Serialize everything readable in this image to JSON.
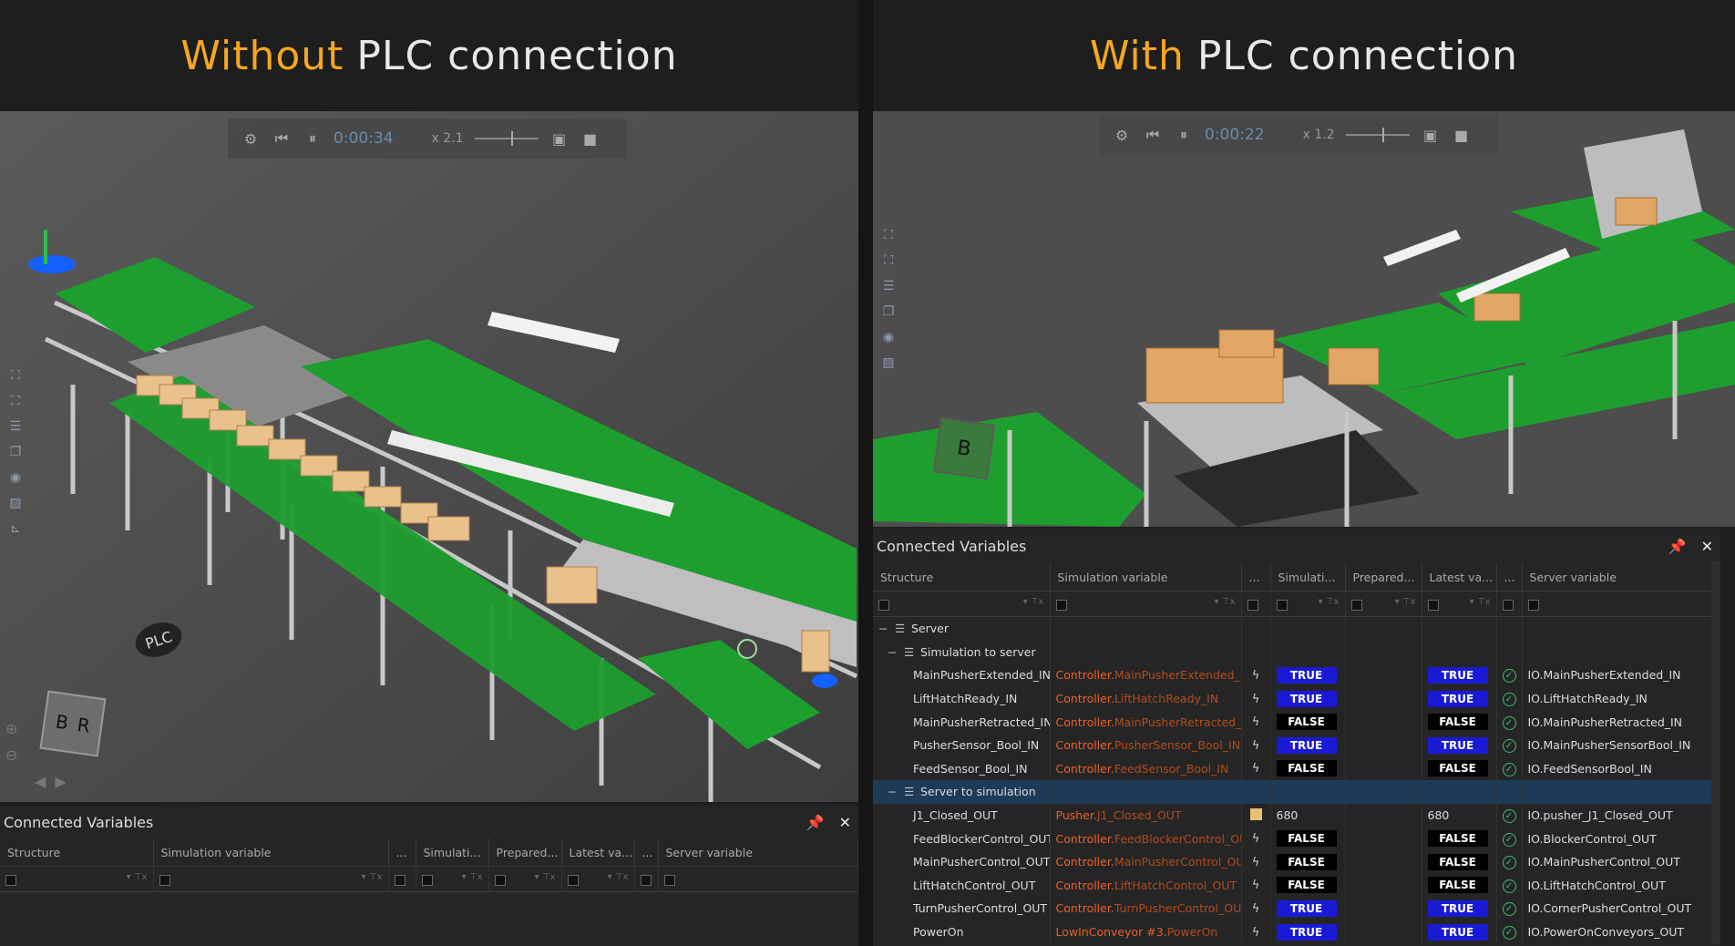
{
  "titles": {
    "left": {
      "accent": "Without",
      "rest": "PLC connection"
    },
    "right": {
      "accent": "With",
      "rest": "PLC connection"
    }
  },
  "left_toolbar": {
    "time": "0:00:34",
    "speed": "x 2.1"
  },
  "right_toolbar": {
    "time": "0:00:22",
    "speed": "x 1.2"
  },
  "scene": {
    "plc_label": "PLC",
    "cube_left": "B",
    "cube_right": "R"
  },
  "left_cv": {
    "title": "Connected Variables",
    "columns": [
      "Structure",
      "Simulation variable",
      "...",
      "Simulati...",
      "Prepared...",
      "Latest va...",
      "...",
      "Server variable"
    ]
  },
  "right_cv": {
    "title": "Connected Variables",
    "columns": [
      "Structure",
      "Simulation variable",
      "...",
      "Simulati...",
      "Prepared...",
      "Latest va...",
      "...",
      "Server variable"
    ],
    "root": "Server",
    "group1": "Simulation to server",
    "group1_rows": [
      {
        "name": "MainPusherExtended_IN",
        "owner": "Controller.",
        "var": "MainPusherExtended_IN",
        "sim": "TRUE",
        "latest": "TRUE",
        "server": "IO.MainPusherExtended_IN"
      },
      {
        "name": "LiftHatchReady_IN",
        "owner": "Controller.",
        "var": "LiftHatchReady_IN",
        "sim": "TRUE",
        "latest": "TRUE",
        "server": "IO.LiftHatchReady_IN"
      },
      {
        "name": "MainPusherRetracted_IN",
        "owner": "Controller.",
        "var": "MainPusherRetracted_IN",
        "sim": "FALSE",
        "latest": "FALSE",
        "server": "IO.MainPusherRetracted_IN"
      },
      {
        "name": "PusherSensor_Bool_IN",
        "owner": "Controller.",
        "var": "PusherSensor_Bool_IN",
        "sim": "TRUE",
        "latest": "TRUE",
        "server": "IO.MainPusherSensorBool_IN"
      },
      {
        "name": "FeedSensor_Bool_IN",
        "owner": "Controller.",
        "var": "FeedSensor_Bool_IN",
        "sim": "FALSE",
        "latest": "FALSE",
        "server": "IO.FeedSensorBool_IN"
      }
    ],
    "group2": "Server to simulation",
    "group2_rows": [
      {
        "name": "J1_Closed_OUT",
        "owner": "Pusher.",
        "var": "J1_Closed_OUT",
        "sim": "680",
        "latest": "680",
        "server": "IO.pusher_J1_Closed_OUT"
      },
      {
        "name": "FeedBlockerControl_OUT",
        "owner": "Controller.",
        "var": "FeedBlockerControl_OUT",
        "sim": "FALSE",
        "latest": "FALSE",
        "server": "IO.BlockerControl_OUT"
      },
      {
        "name": "MainPusherControl_OUT",
        "owner": "Controller.",
        "var": "MainPusherControl_OUT",
        "sim": "FALSE",
        "latest": "FALSE",
        "server": "IO.MainPusherControl_OUT"
      },
      {
        "name": "LiftHatchControl_OUT",
        "owner": "Controller.",
        "var": "LiftHatchControl_OUT",
        "sim": "FALSE",
        "latest": "FALSE",
        "server": "IO.LiftHatchControl_OUT"
      },
      {
        "name": "TurnPusherControl_OUT",
        "owner": "Controller.",
        "var": "TurnPusherControl_OUT",
        "sim": "TRUE",
        "latest": "TRUE",
        "server": "IO.CornerPusherControl_OUT"
      },
      {
        "name": "PowerOn",
        "owner": "LowInConveyor #3.",
        "var": "PowerOn",
        "sim": "TRUE",
        "latest": "TRUE",
        "server": "IO.PowerOnConveyors_OUT"
      }
    ]
  },
  "colors": {
    "true_bg": "#1a1ad6",
    "false_bg": "#000000",
    "accent": "#f5a623",
    "conveyor": "#1e9e2e"
  }
}
